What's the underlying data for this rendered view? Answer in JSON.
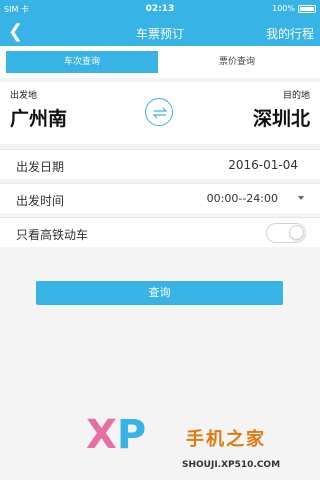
{
  "status_bar": {
    "carrier": "SIM 卡",
    "time": "02:13",
    "battery": "100%"
  },
  "header": {
    "title": "车票预订",
    "right_action": "我的行程"
  },
  "tabs": [
    "车次查询",
    "票价查询"
  ],
  "route": {
    "from_label": "出发地",
    "to_label": "目的地",
    "from_station": "广州南",
    "to_station": "深圳北"
  },
  "form": {
    "date_label": "出发日期",
    "date_value": "2016-01-04",
    "time_label": "出发时间",
    "time_value": "00:00--24:00",
    "highspeed_label": "只看高铁动车",
    "highspeed_on": false
  },
  "query_button": "查询",
  "watermark": {
    "logo_x": "X",
    "logo_p": "P",
    "text": "手机之家",
    "url": "SHOUJI.XP510.COM"
  },
  "colors": {
    "accent": "#37b3e5"
  }
}
